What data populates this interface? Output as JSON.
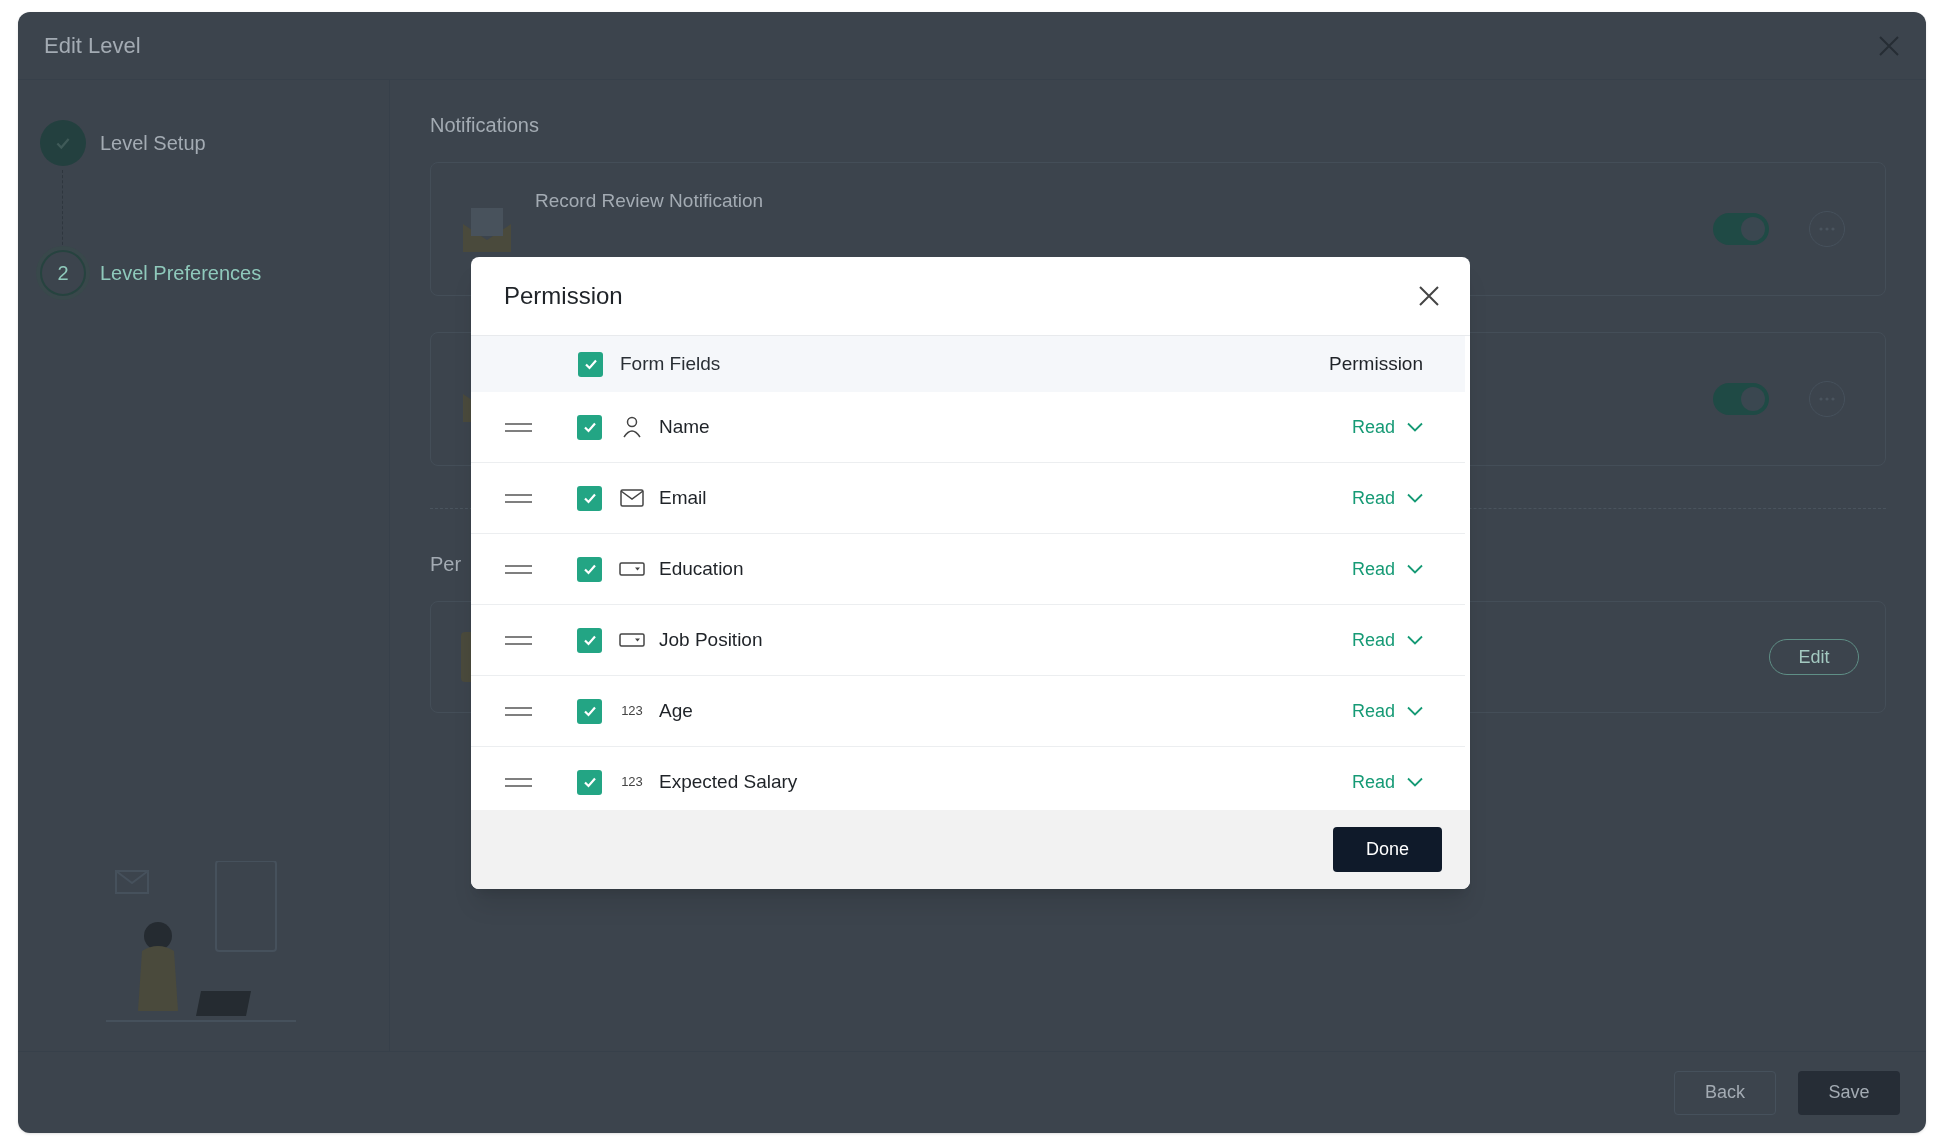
{
  "window": {
    "title": "Edit Level"
  },
  "steps": [
    {
      "kind": "done",
      "label": "Level Setup"
    },
    {
      "kind": "current",
      "number": "2",
      "label": "Level Preferences"
    }
  ],
  "notifications": {
    "heading": "Notifications",
    "cards": [
      {
        "title": "Record Review Notification",
        "on": true
      },
      {
        "on": true
      }
    ]
  },
  "permissions_section": {
    "heading": "Per",
    "edit_button": "Edit"
  },
  "footer": {
    "back": "Back",
    "save": "Save"
  },
  "modal": {
    "title": "Permission",
    "header": {
      "checked": true,
      "label": "Form Fields",
      "column": "Permission"
    },
    "rows": [
      {
        "kind": "person",
        "label": "Name",
        "checked": true,
        "permission": "Read"
      },
      {
        "kind": "mail",
        "label": "Email",
        "checked": true,
        "permission": "Read"
      },
      {
        "kind": "dropdown",
        "label": "Education",
        "checked": true,
        "permission": "Read"
      },
      {
        "kind": "dropdown",
        "label": "Job Position",
        "checked": true,
        "permission": "Read"
      },
      {
        "kind": "number",
        "type_glyph": "123",
        "label": "Age",
        "checked": true,
        "permission": "Read"
      },
      {
        "kind": "number",
        "type_glyph": "123",
        "label": "Expected Salary",
        "checked": true,
        "permission": "Read"
      }
    ],
    "done": "Done"
  }
}
